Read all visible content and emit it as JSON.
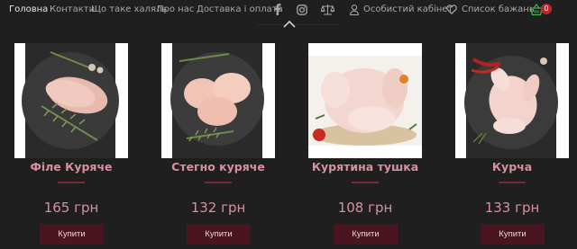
{
  "nav": {
    "items": [
      {
        "label": "Головна",
        "active": true
      },
      {
        "label": "Контакти",
        "active": false
      },
      {
        "label": "Що таке халяль",
        "active": false
      },
      {
        "label": "Про нас",
        "active": false
      },
      {
        "label": "Доставка і оплата",
        "active": false
      }
    ],
    "social_icons": [
      "facebook-icon",
      "instagram-icon",
      "scales-icon"
    ],
    "cabinet_label": "Особистий кабінет",
    "wishlist_label": "Список бажань",
    "cart_count": "0"
  },
  "colors": {
    "background": "#1f1f1f",
    "accent_text": "#d8909f",
    "button": "#4a1420",
    "badge": "#c0232f",
    "cart_icon": "#3fb34a"
  },
  "products": [
    {
      "name": "Філе Куряче",
      "price": "165 грн",
      "button": "Купити"
    },
    {
      "name": "Стегно куряче",
      "price": "132 грн",
      "button": "Купити"
    },
    {
      "name": "Курятина тушка",
      "price": "108 грн",
      "button": "Купити"
    },
    {
      "name": "Курча",
      "price": "133 грн",
      "button": "Купити"
    }
  ]
}
